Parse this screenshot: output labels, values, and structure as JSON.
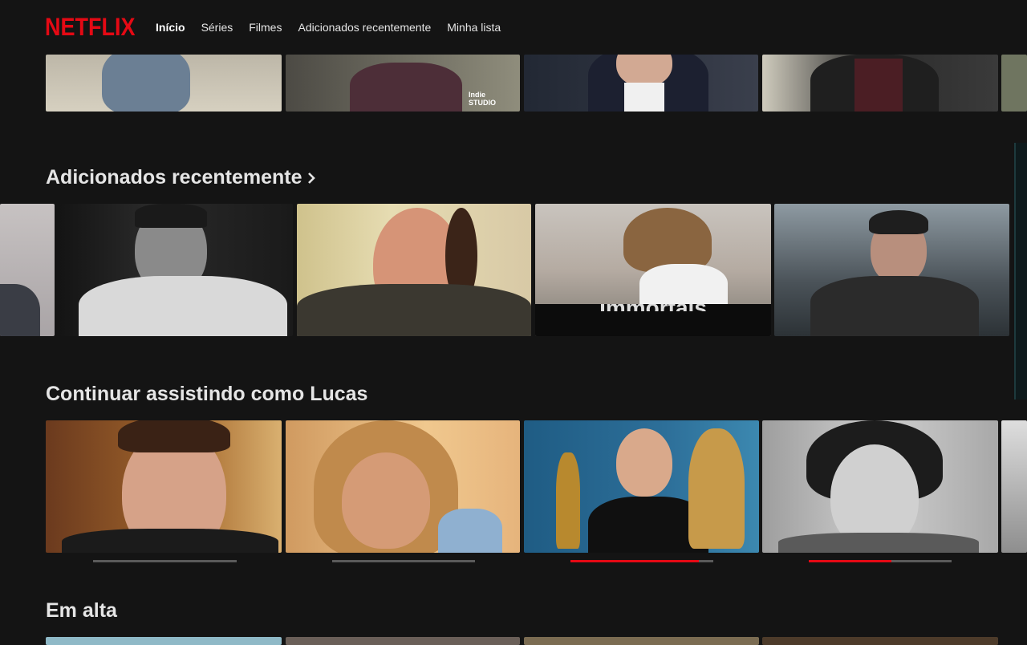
{
  "header": {
    "logo": "NETFLIX",
    "nav": [
      {
        "label": "Início",
        "active": true
      },
      {
        "label": "Séries",
        "active": false
      },
      {
        "label": "Filmes",
        "active": false
      },
      {
        "label": "Adicionados recentemente",
        "active": false
      },
      {
        "label": "Minha lista",
        "active": false
      }
    ]
  },
  "rows": {
    "recently_added": {
      "title": "Adicionados recentemente"
    },
    "continue_watching": {
      "title": "Continuar assistindo como Lucas",
      "progress": [
        0.0,
        0.0,
        0.9,
        0.58
      ]
    },
    "trending": {
      "title": "Em alta"
    }
  },
  "tile_overlay_text": "Immortals",
  "watermark_text": "Indie STUDIO",
  "colors": {
    "background": "#141414",
    "brand": "#e50914",
    "text": "#e5e5e5",
    "progress_track": "#5a5a5a"
  },
  "icons": [
    "chevron-right-icon"
  ]
}
